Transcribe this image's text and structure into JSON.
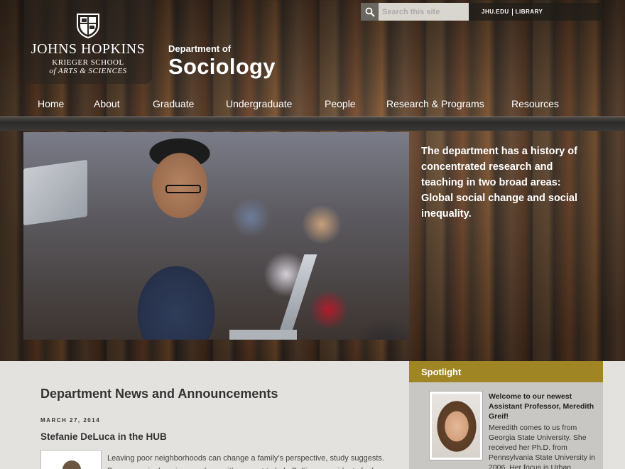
{
  "brand": {
    "university": "JOHNS HOPKINS",
    "school_line1": "KRIEGER SCHOOL",
    "school_line2": "of ARTS & SCIENCES",
    "department_prefix": "Department of",
    "department_name": "Sociology"
  },
  "utility": {
    "search_placeholder": "Search this site",
    "links": [
      "JHU.EDU",
      "LIBRARY"
    ]
  },
  "nav": {
    "items": [
      "Home",
      "About",
      "Graduate",
      "Undergraduate",
      "People",
      "Research & Programs",
      "Resources"
    ]
  },
  "hero": {
    "text": "The department has a history of concentrated research and teaching in two broad areas: Global social change and social inequality."
  },
  "news": {
    "title": "Department News and Announcements",
    "date": "MARCH 27, 2014",
    "headline": "Stefanie DeLuca in the HUB",
    "body": "Leaving poor neighborhoods can change a family’s perspective, study suggests. Program pairs housing vouchers with support to help Baltimore residents feel"
  },
  "spotlight": {
    "heading": "Spotlight",
    "title": "Welcome to our newest Assistant Professor, Meredith Greif!",
    "body": "Meredith comes to us from Georgia State University. She received her Ph.D. from Pennsylvania State University in 2006. Her focus is Urban"
  },
  "colors": {
    "spotlight_accent": "#a08524",
    "content_bg": "#e4e2de"
  }
}
